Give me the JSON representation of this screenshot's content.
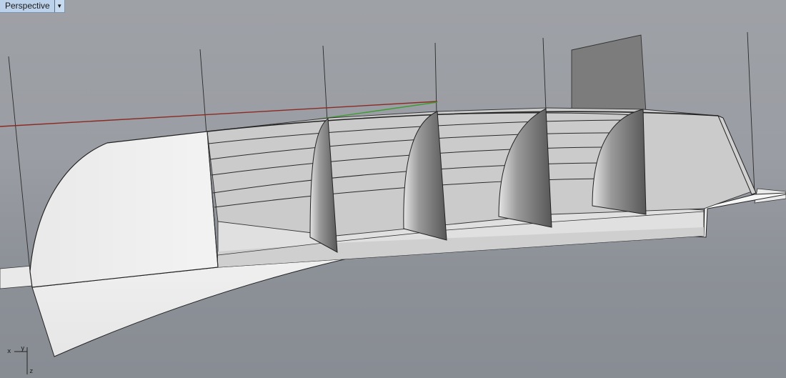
{
  "viewport": {
    "name": "Perspective",
    "dropdown_icon": "triangle-down-icon"
  },
  "axis_labels": {
    "x": "x",
    "y": "y",
    "z": "z"
  },
  "colors": {
    "background": "#9a9da3",
    "tab_background": "#bcd2ea",
    "x_axis": "#8a2b23",
    "y_axis": "#3f9b32",
    "hull_surface": "#ececec",
    "inner_bottom": "#e2e2e2",
    "bulkhead": "#707070",
    "transom_plane": "#7c7c7c"
  }
}
